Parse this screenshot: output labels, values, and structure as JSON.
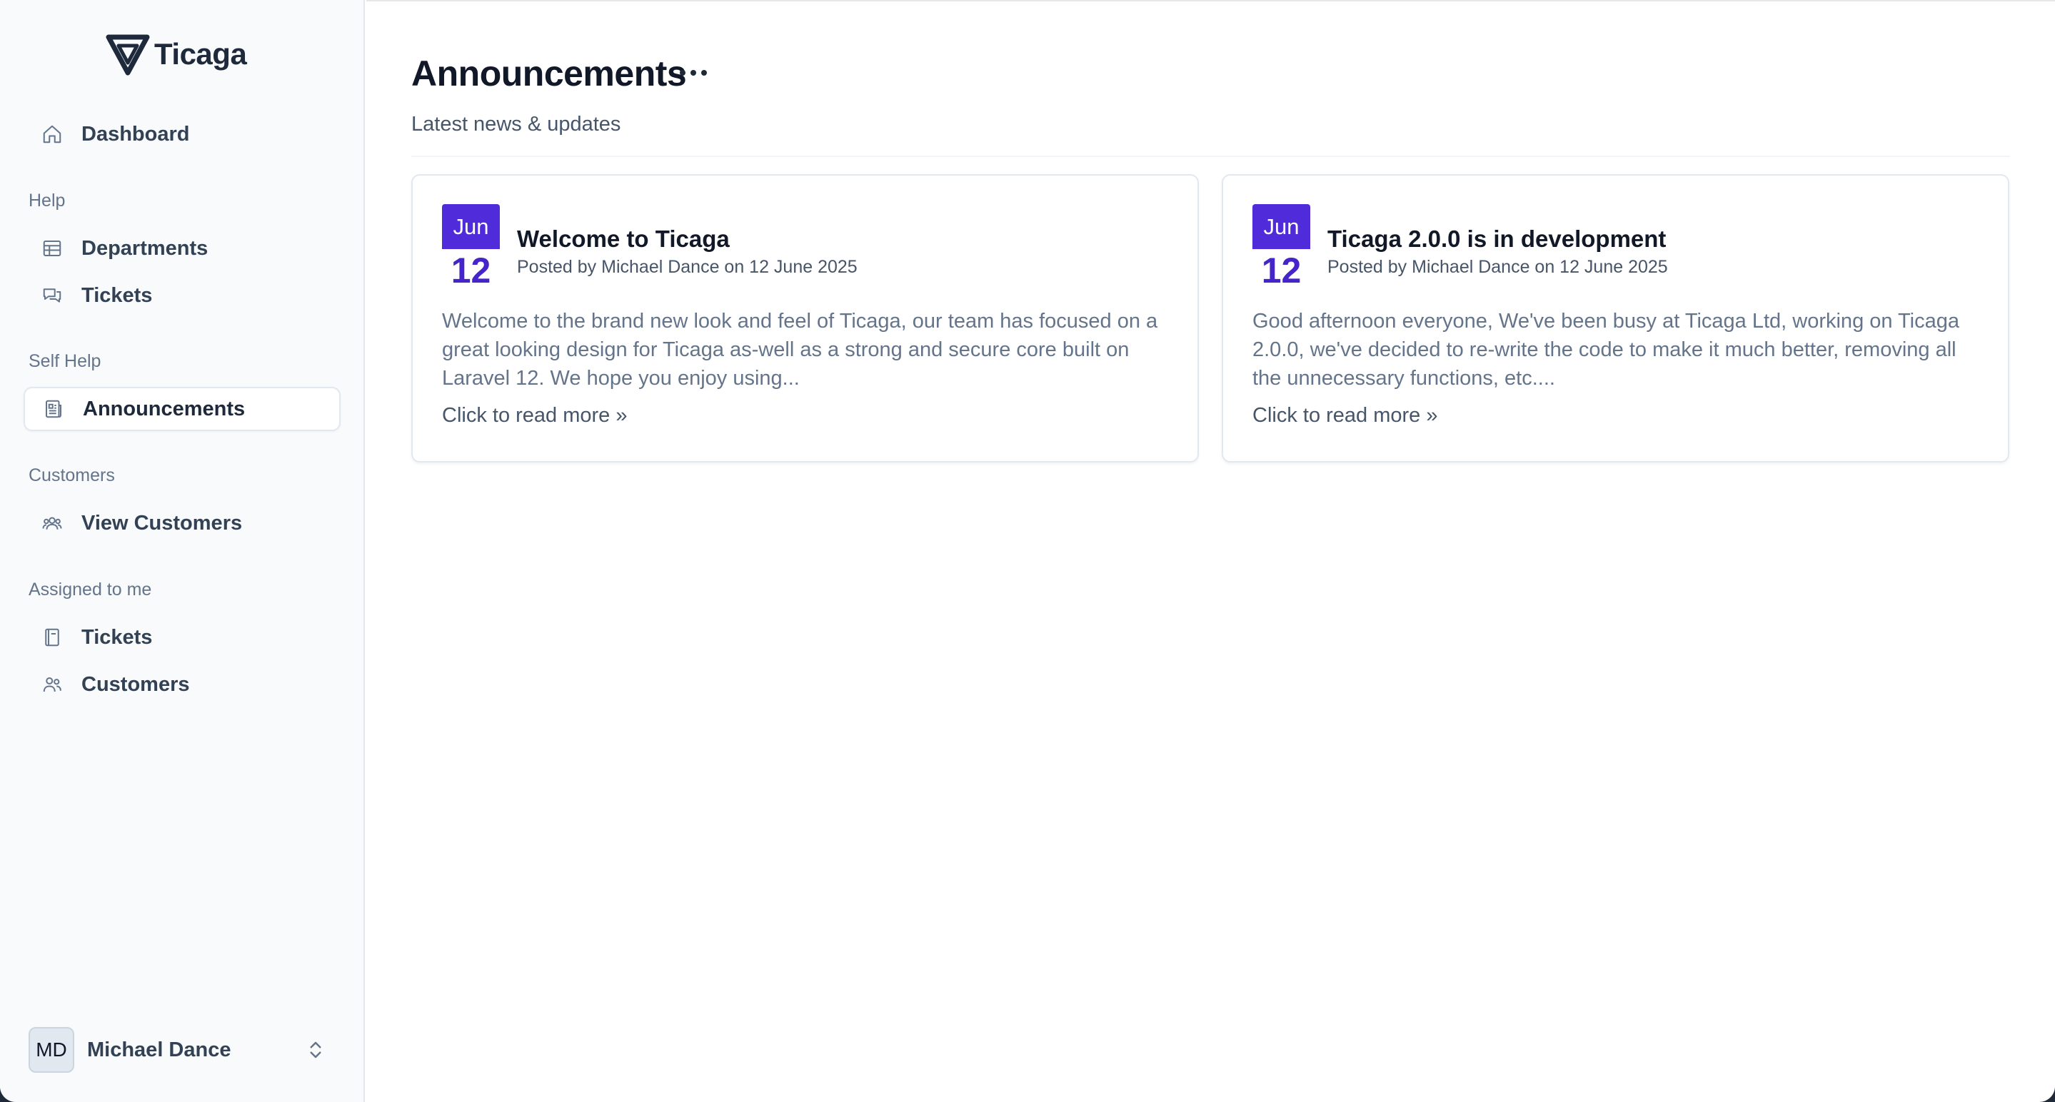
{
  "app": {
    "name": "Ticaga"
  },
  "sidebar": {
    "dashboard": "Dashboard",
    "sections": {
      "help": "Help",
      "self_help": "Self Help",
      "customers": "Customers",
      "assigned": "Assigned to me"
    },
    "items": {
      "departments": "Departments",
      "tickets": "Tickets",
      "announcements": "Announcements",
      "view_customers": "View Customers",
      "assigned_tickets": "Tickets",
      "assigned_customers": "Customers"
    },
    "active_item": "announcements",
    "user": {
      "initials": "MD",
      "name": "Michael Dance"
    }
  },
  "main": {
    "title": "Announcements",
    "subtitle": "Latest news & updates",
    "announcements": [
      {
        "month": "Jun",
        "day": "12",
        "title": "Welcome to Ticaga",
        "meta": "Posted by Michael Dance on 12 June 2025",
        "body": "Welcome to the brand new look and feel of Ticaga, our team has focused on a great looking design for Ticaga as-well as a strong and secure core built on Laravel 12. We hope you enjoy using...",
        "link": "Click to read more »"
      },
      {
        "month": "Jun",
        "day": "12",
        "title": "Ticaga 2.0.0 is in development",
        "meta": "Posted by Michael Dance on 12 June 2025",
        "body": "Good afternoon everyone, We've been busy at Ticaga Ltd, working on Ticaga 2.0.0, we've decided to re-write the code to make it much better, removing all the unnecessary functions, etc....",
        "link": "Click to read more »"
      }
    ]
  },
  "colors": {
    "accent": "#4f2bd9",
    "accent_text": "#4524c9",
    "sidebar_bg": "#f8fafc",
    "text_primary": "#111827",
    "text_muted": "#64748b"
  },
  "icons": {
    "logo": "ticaga-logo-icon",
    "dashboard": "home-icon",
    "departments": "table-icon",
    "tickets": "chat-bubbles-icon",
    "announcements": "newspaper-icon",
    "view_customers": "user-group-icon",
    "assigned_tickets": "book-icon",
    "assigned_customers": "users-icon",
    "more": "ellipsis-icon",
    "user_toggle": "chevron-up-down-icon"
  }
}
